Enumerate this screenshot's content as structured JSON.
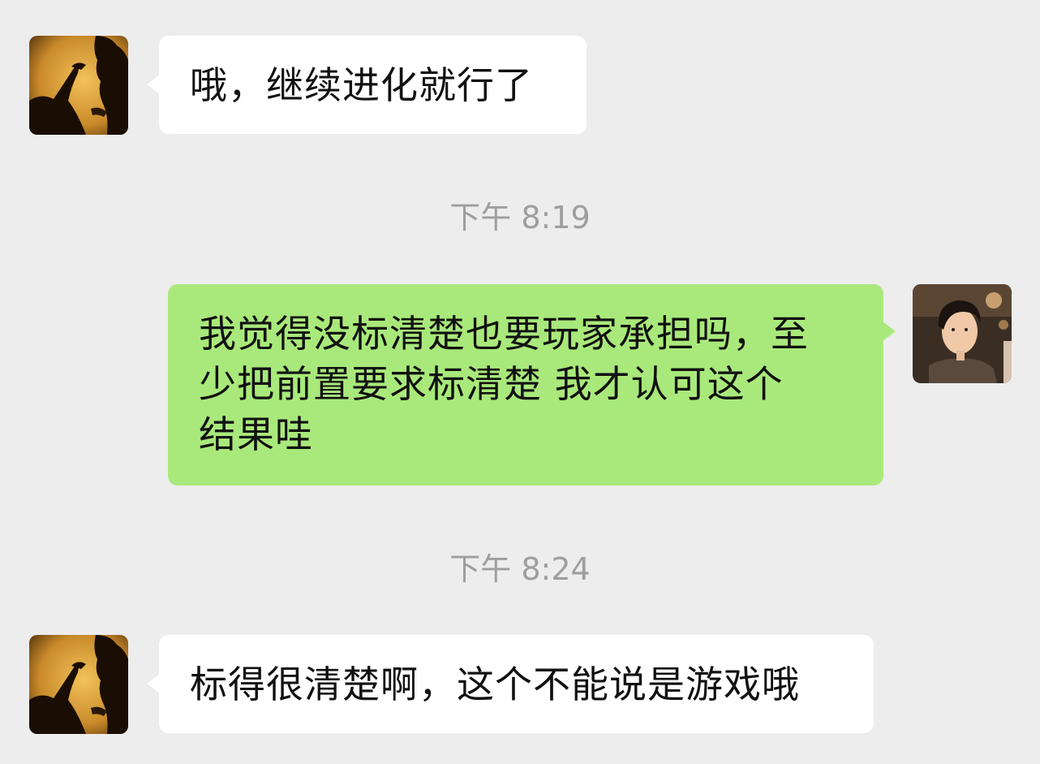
{
  "messages": [
    {
      "sender": "other",
      "text": "哦，继续进化就行了"
    },
    {
      "sender": "self",
      "text": "我觉得没标清楚也要玩家承担吗，至\n少把前置要求标清楚 我才认可这个\n结果哇"
    },
    {
      "sender": "other",
      "text": "标得很清楚啊，这个不能说是游戏哦"
    }
  ],
  "timestamps": [
    "下午 8:19",
    "下午 8:24"
  ],
  "colors": {
    "background": "#ededed",
    "incoming_bubble": "#ffffff",
    "outgoing_bubble": "#a9e97b",
    "timestamp_text": "#9e9e9e"
  },
  "icons": {
    "other_avatar": "silhouette-photo-avatar",
    "self_avatar": "portrait-photo-avatar"
  }
}
